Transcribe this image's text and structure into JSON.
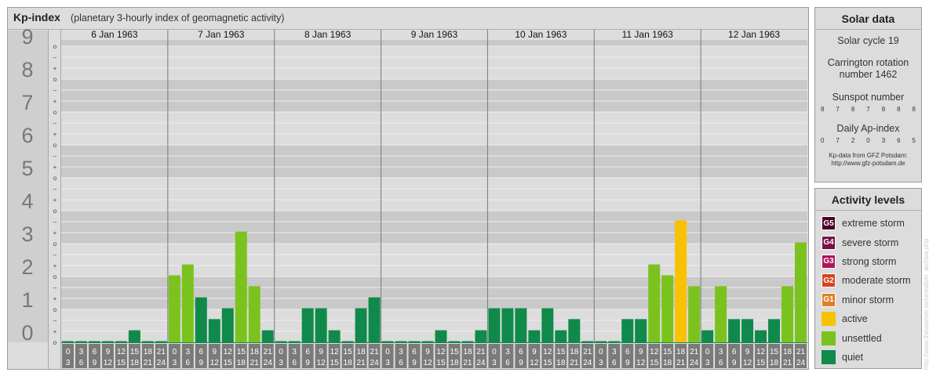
{
  "chart_data": {
    "type": "bar",
    "title": "Kp-index",
    "subtitle": "(planetary 3-hourly index of geomagnetic activity)",
    "days": [
      "6 Jan 1963",
      "7 Jan 1963",
      "8 Jan 1963",
      "9 Jan 1963",
      "10 Jan 1963",
      "11 Jan 1963",
      "12 Jan 1963"
    ],
    "slot_start_labels": [
      "0",
      "3",
      "6",
      "9",
      "12",
      "15",
      "18",
      "21"
    ],
    "slot_end_labels": [
      "3",
      "6",
      "9",
      "12",
      "15",
      "18",
      "21",
      "24"
    ],
    "y_labels": [
      "0",
      "1",
      "2",
      "3",
      "4",
      "5",
      "6",
      "7",
      "8",
      "9"
    ],
    "sub_labels": [
      "o",
      "+",
      "–"
    ],
    "ylim": [
      0,
      9.33
    ],
    "values": [
      [
        0,
        0,
        0,
        0,
        0,
        0.33,
        0,
        0
      ],
      [
        2,
        2.33,
        1.33,
        0.67,
        1,
        3.33,
        1.67,
        0.33
      ],
      [
        0,
        0,
        1,
        1,
        0.33,
        0,
        1,
        1.33
      ],
      [
        0,
        0,
        0,
        0,
        0.33,
        0,
        0,
        0.33
      ],
      [
        1,
        1,
        1,
        0.33,
        1,
        0.33,
        0.67,
        0
      ],
      [
        0,
        0,
        0.67,
        0.67,
        2.33,
        2,
        3.67,
        1.67
      ],
      [
        0.33,
        1.67,
        0.67,
        0.67,
        0.33,
        0.67,
        1.67,
        3
      ]
    ],
    "level_colors": {
      "quiet": "#0f8a4a",
      "unsettled": "#7cc21f",
      "active": "#f8c200",
      "g1": "#e08020",
      "g2": "#d8421f",
      "g3": "#b0145a",
      "g4": "#7a1048",
      "g5": "#4a0028"
    }
  },
  "solar": {
    "title": "Solar data",
    "cycle": "Solar cycle 19",
    "carrington": "Carrington rotation number 1462",
    "sunspot_label": "Sunspot number",
    "sunspot_values": [
      "8",
      "7",
      "8",
      "7",
      "8",
      "8",
      "8"
    ],
    "ap_label": "Daily Ap-index",
    "ap_values": [
      "0",
      "7",
      "2",
      "0",
      "3",
      "6",
      "5"
    ],
    "credit_line1": "Kp-data from GFZ Potsdam:",
    "credit_line2": "http://www.gfz-potsdam.de"
  },
  "activity": {
    "title": "Activity levels",
    "items": [
      {
        "badge": "G5",
        "label": "extreme storm",
        "color": "#4a0028"
      },
      {
        "badge": "G4",
        "label": "severe storm",
        "color": "#7a1048"
      },
      {
        "badge": "G3",
        "label": "strong storm",
        "color": "#b0145a"
      },
      {
        "badge": "G2",
        "label": "moderate storm",
        "color": "#d8421f"
      },
      {
        "badge": "G1",
        "label": "minor storm",
        "color": "#e08020"
      },
      {
        "badge": "",
        "label": "active",
        "color": "#f8c200"
      },
      {
        "badge": "",
        "label": "unsettled",
        "color": "#7cc21f"
      },
      {
        "badge": "",
        "label": "quiet",
        "color": "#0f8a4a"
      }
    ]
  },
  "watermark": "http://www.theuserver.de/urorab/in_archive.php"
}
